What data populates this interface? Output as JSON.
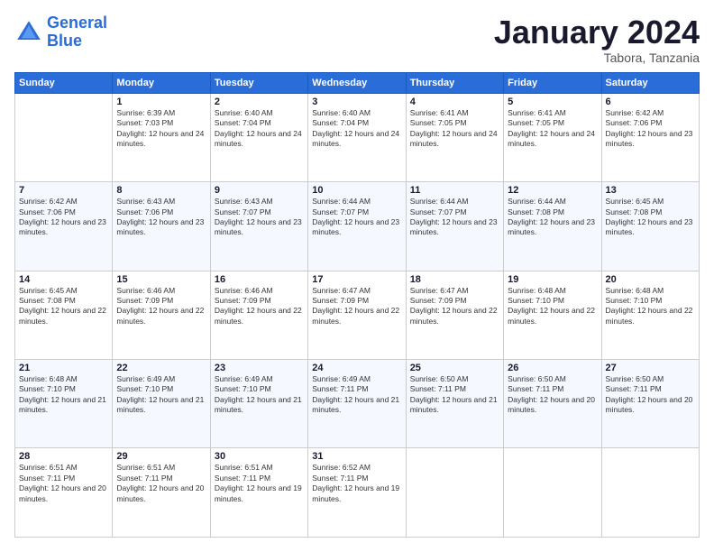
{
  "logo": {
    "line1": "General",
    "line2": "Blue"
  },
  "header": {
    "month": "January 2024",
    "location": "Tabora, Tanzania"
  },
  "weekdays": [
    "Sunday",
    "Monday",
    "Tuesday",
    "Wednesday",
    "Thursday",
    "Friday",
    "Saturday"
  ],
  "weeks": [
    [
      {
        "day": "",
        "sunrise": "",
        "sunset": "",
        "daylight": ""
      },
      {
        "day": "1",
        "sunrise": "Sunrise: 6:39 AM",
        "sunset": "Sunset: 7:03 PM",
        "daylight": "Daylight: 12 hours and 24 minutes."
      },
      {
        "day": "2",
        "sunrise": "Sunrise: 6:40 AM",
        "sunset": "Sunset: 7:04 PM",
        "daylight": "Daylight: 12 hours and 24 minutes."
      },
      {
        "day": "3",
        "sunrise": "Sunrise: 6:40 AM",
        "sunset": "Sunset: 7:04 PM",
        "daylight": "Daylight: 12 hours and 24 minutes."
      },
      {
        "day": "4",
        "sunrise": "Sunrise: 6:41 AM",
        "sunset": "Sunset: 7:05 PM",
        "daylight": "Daylight: 12 hours and 24 minutes."
      },
      {
        "day": "5",
        "sunrise": "Sunrise: 6:41 AM",
        "sunset": "Sunset: 7:05 PM",
        "daylight": "Daylight: 12 hours and 24 minutes."
      },
      {
        "day": "6",
        "sunrise": "Sunrise: 6:42 AM",
        "sunset": "Sunset: 7:06 PM",
        "daylight": "Daylight: 12 hours and 23 minutes."
      }
    ],
    [
      {
        "day": "7",
        "sunrise": "Sunrise: 6:42 AM",
        "sunset": "Sunset: 7:06 PM",
        "daylight": "Daylight: 12 hours and 23 minutes."
      },
      {
        "day": "8",
        "sunrise": "Sunrise: 6:43 AM",
        "sunset": "Sunset: 7:06 PM",
        "daylight": "Daylight: 12 hours and 23 minutes."
      },
      {
        "day": "9",
        "sunrise": "Sunrise: 6:43 AM",
        "sunset": "Sunset: 7:07 PM",
        "daylight": "Daylight: 12 hours and 23 minutes."
      },
      {
        "day": "10",
        "sunrise": "Sunrise: 6:44 AM",
        "sunset": "Sunset: 7:07 PM",
        "daylight": "Daylight: 12 hours and 23 minutes."
      },
      {
        "day": "11",
        "sunrise": "Sunrise: 6:44 AM",
        "sunset": "Sunset: 7:07 PM",
        "daylight": "Daylight: 12 hours and 23 minutes."
      },
      {
        "day": "12",
        "sunrise": "Sunrise: 6:44 AM",
        "sunset": "Sunset: 7:08 PM",
        "daylight": "Daylight: 12 hours and 23 minutes."
      },
      {
        "day": "13",
        "sunrise": "Sunrise: 6:45 AM",
        "sunset": "Sunset: 7:08 PM",
        "daylight": "Daylight: 12 hours and 23 minutes."
      }
    ],
    [
      {
        "day": "14",
        "sunrise": "Sunrise: 6:45 AM",
        "sunset": "Sunset: 7:08 PM",
        "daylight": "Daylight: 12 hours and 22 minutes."
      },
      {
        "day": "15",
        "sunrise": "Sunrise: 6:46 AM",
        "sunset": "Sunset: 7:09 PM",
        "daylight": "Daylight: 12 hours and 22 minutes."
      },
      {
        "day": "16",
        "sunrise": "Sunrise: 6:46 AM",
        "sunset": "Sunset: 7:09 PM",
        "daylight": "Daylight: 12 hours and 22 minutes."
      },
      {
        "day": "17",
        "sunrise": "Sunrise: 6:47 AM",
        "sunset": "Sunset: 7:09 PM",
        "daylight": "Daylight: 12 hours and 22 minutes."
      },
      {
        "day": "18",
        "sunrise": "Sunrise: 6:47 AM",
        "sunset": "Sunset: 7:09 PM",
        "daylight": "Daylight: 12 hours and 22 minutes."
      },
      {
        "day": "19",
        "sunrise": "Sunrise: 6:48 AM",
        "sunset": "Sunset: 7:10 PM",
        "daylight": "Daylight: 12 hours and 22 minutes."
      },
      {
        "day": "20",
        "sunrise": "Sunrise: 6:48 AM",
        "sunset": "Sunset: 7:10 PM",
        "daylight": "Daylight: 12 hours and 22 minutes."
      }
    ],
    [
      {
        "day": "21",
        "sunrise": "Sunrise: 6:48 AM",
        "sunset": "Sunset: 7:10 PM",
        "daylight": "Daylight: 12 hours and 21 minutes."
      },
      {
        "day": "22",
        "sunrise": "Sunrise: 6:49 AM",
        "sunset": "Sunset: 7:10 PM",
        "daylight": "Daylight: 12 hours and 21 minutes."
      },
      {
        "day": "23",
        "sunrise": "Sunrise: 6:49 AM",
        "sunset": "Sunset: 7:10 PM",
        "daylight": "Daylight: 12 hours and 21 minutes."
      },
      {
        "day": "24",
        "sunrise": "Sunrise: 6:49 AM",
        "sunset": "Sunset: 7:11 PM",
        "daylight": "Daylight: 12 hours and 21 minutes."
      },
      {
        "day": "25",
        "sunrise": "Sunrise: 6:50 AM",
        "sunset": "Sunset: 7:11 PM",
        "daylight": "Daylight: 12 hours and 21 minutes."
      },
      {
        "day": "26",
        "sunrise": "Sunrise: 6:50 AM",
        "sunset": "Sunset: 7:11 PM",
        "daylight": "Daylight: 12 hours and 20 minutes."
      },
      {
        "day": "27",
        "sunrise": "Sunrise: 6:50 AM",
        "sunset": "Sunset: 7:11 PM",
        "daylight": "Daylight: 12 hours and 20 minutes."
      }
    ],
    [
      {
        "day": "28",
        "sunrise": "Sunrise: 6:51 AM",
        "sunset": "Sunset: 7:11 PM",
        "daylight": "Daylight: 12 hours and 20 minutes."
      },
      {
        "day": "29",
        "sunrise": "Sunrise: 6:51 AM",
        "sunset": "Sunset: 7:11 PM",
        "daylight": "Daylight: 12 hours and 20 minutes."
      },
      {
        "day": "30",
        "sunrise": "Sunrise: 6:51 AM",
        "sunset": "Sunset: 7:11 PM",
        "daylight": "Daylight: 12 hours and 19 minutes."
      },
      {
        "day": "31",
        "sunrise": "Sunrise: 6:52 AM",
        "sunset": "Sunset: 7:11 PM",
        "daylight": "Daylight: 12 hours and 19 minutes."
      },
      {
        "day": "",
        "sunrise": "",
        "sunset": "",
        "daylight": ""
      },
      {
        "day": "",
        "sunrise": "",
        "sunset": "",
        "daylight": ""
      },
      {
        "day": "",
        "sunrise": "",
        "sunset": "",
        "daylight": ""
      }
    ]
  ]
}
